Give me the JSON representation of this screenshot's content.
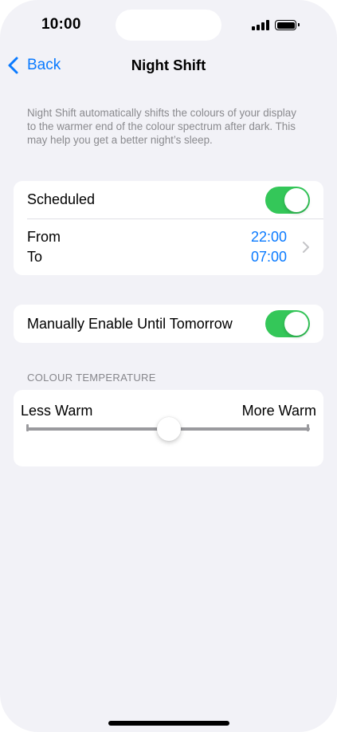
{
  "status_bar": {
    "time": "10:00",
    "signal_bars": 4,
    "battery_level": 1.0
  },
  "nav": {
    "back_label": "Back",
    "title": "Night Shift",
    "back_icon": "chevron-left-icon"
  },
  "description": "Night Shift automatically shifts the colours of your display to the warmer end of the colour spectrum after dark. This may help you get a better night’s sleep.",
  "scheduled": {
    "label": "Scheduled",
    "enabled": true,
    "from_label": "From",
    "to_label": "To",
    "from_time": "22:00",
    "to_time": "07:00"
  },
  "manual": {
    "label": "Manually Enable Until Tomorrow",
    "enabled": true
  },
  "colour_temperature": {
    "header": "COLOUR TEMPERATURE",
    "less_label": "Less Warm",
    "more_label": "More Warm",
    "value": 0.5
  },
  "colors": {
    "accent": "#0a7aff",
    "toggle_on": "#34c759",
    "background": "#f2f2f7",
    "secondary_text": "#8a8a8e"
  }
}
